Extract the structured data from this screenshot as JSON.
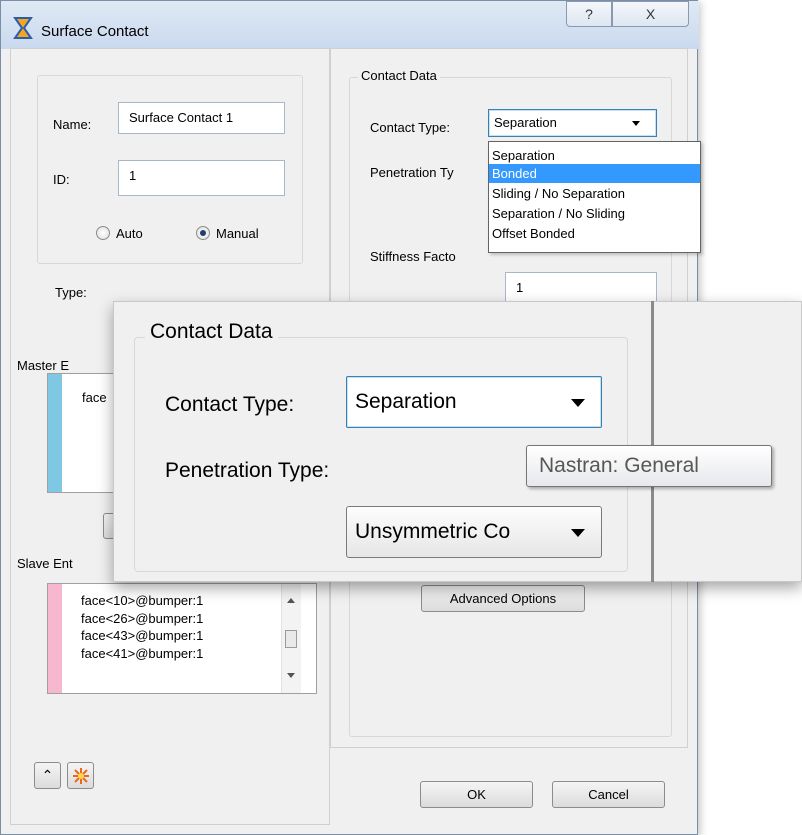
{
  "window": {
    "title": "Surface Contact",
    "help_glyph": "?",
    "close_glyph": "X"
  },
  "left": {
    "name_label": "Name:",
    "name_value": "Surface Contact 1",
    "id_label": "ID:",
    "id_value": "1",
    "radio_auto": "Auto",
    "radio_manual": "Manual",
    "selected_mode": "Manual",
    "type_label": "Type:",
    "master_label": "Master E",
    "master_items": [
      "face"
    ],
    "slave_label": "Slave Ent",
    "slave_items": [
      "face<10>@bumper:1",
      "face<26>@bumper:1",
      "face<43>@bumper:1",
      "face<41>@bumper:1"
    ],
    "master_color": "#7ec8e3",
    "slave_color": "#f6b7cf"
  },
  "right": {
    "group_title": "Contact Data",
    "contact_type_label": "Contact Type:",
    "contact_type_value": "Separation",
    "contact_type_options": [
      "Separation",
      "Bonded",
      "Sliding / No Separation",
      "Separation / No Sliding",
      "Offset Bonded"
    ],
    "highlighted_option": "Bonded",
    "penetration_label": "Penetration Ty",
    "stiffness_label": "Stiffness Facto",
    "stiffness_value": "1",
    "advanced_button": "Advanced Options"
  },
  "footer": {
    "ok_label": "OK",
    "cancel_label": "Cancel"
  },
  "zoom": {
    "group_title": "Contact Data",
    "contact_type_label": "Contact Type:",
    "contact_type_value": "Separation",
    "penetration_label": "Penetration Type:",
    "penetration_value": "Unsymmetric Co",
    "tooltip": "Nastran: General"
  },
  "colors": {
    "selection": "#3399ff",
    "titlebar": "#c9d9ee"
  }
}
